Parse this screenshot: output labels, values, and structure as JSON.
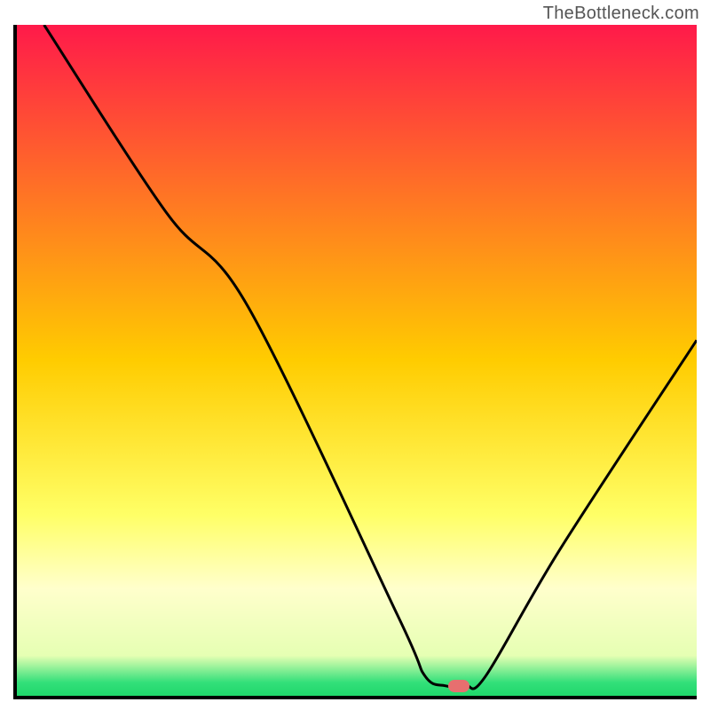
{
  "watermark": "TheBottleneck.com",
  "chart_data": {
    "type": "line",
    "title": "",
    "xlabel": "",
    "ylabel": "",
    "xlim": [
      0,
      100
    ],
    "ylim": [
      0,
      100
    ],
    "curve": {
      "name": "bottleneck-curve",
      "points": [
        {
          "x": 4,
          "y": 100
        },
        {
          "x": 22,
          "y": 72
        },
        {
          "x": 34,
          "y": 58
        },
        {
          "x": 56,
          "y": 12
        },
        {
          "x": 60,
          "y": 3
        },
        {
          "x": 63,
          "y": 1.5
        },
        {
          "x": 66,
          "y": 1.5
        },
        {
          "x": 69,
          "y": 3
        },
        {
          "x": 80,
          "y": 22
        },
        {
          "x": 100,
          "y": 53
        }
      ]
    },
    "marker": {
      "x": 65,
      "y": 1.5,
      "color": "#e76f6f"
    },
    "gradient_stops": [
      {
        "offset": 0,
        "color": "#ff1a4a"
      },
      {
        "offset": 50,
        "color": "#ffcc00"
      },
      {
        "offset": 73,
        "color": "#ffff66"
      },
      {
        "offset": 84,
        "color": "#ffffcc"
      },
      {
        "offset": 94,
        "color": "#e6ffb3"
      },
      {
        "offset": 98,
        "color": "#33e07a"
      },
      {
        "offset": 100,
        "color": "#1fd66a"
      }
    ]
  }
}
